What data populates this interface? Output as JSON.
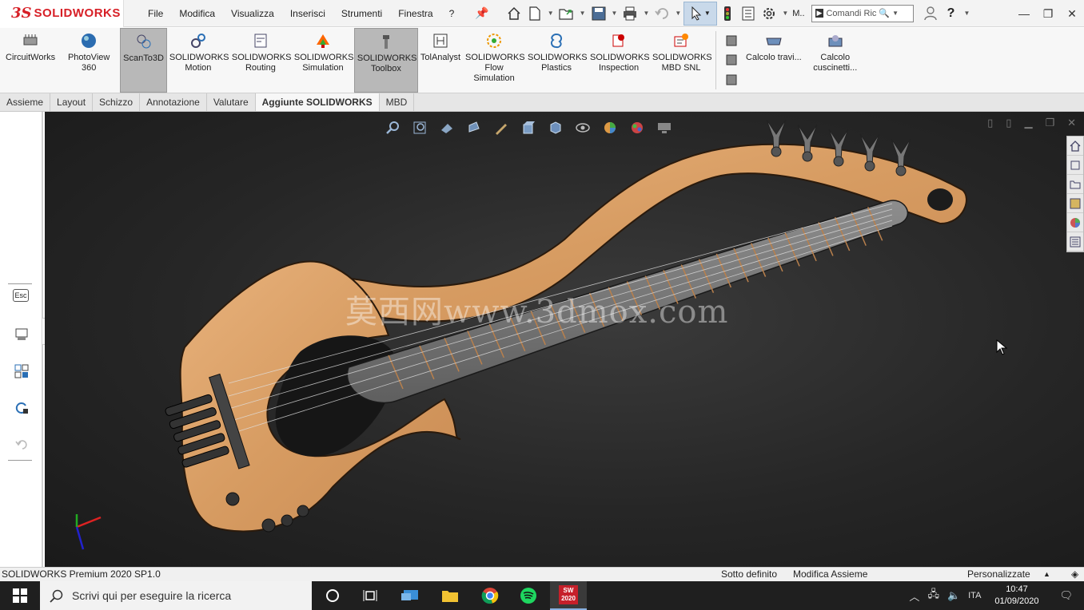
{
  "app": {
    "brand_ds": "3S",
    "brand_name": "SOLIDWORKS"
  },
  "menus": [
    "File",
    "Modifica",
    "Visualizza",
    "Inserisci",
    "Strumenti",
    "Finestra",
    "?"
  ],
  "quick": {
    "selection_dropdown_label": "M..",
    "search_placeholder": "Comandi Ric"
  },
  "ribbon": [
    {
      "label": "CircuitWorks",
      "icon": "circuitworks-icon",
      "active": false
    },
    {
      "label": "PhotoView 360",
      "icon": "photoview-icon",
      "active": false
    },
    {
      "label": "ScanTo3D",
      "icon": "scanto3d-icon",
      "active": true
    },
    {
      "label": "SOLIDWORKS Motion",
      "icon": "motion-icon",
      "active": false
    },
    {
      "label": "SOLIDWORKS Routing",
      "icon": "routing-icon",
      "active": false
    },
    {
      "label": "SOLIDWORKS Simulation",
      "icon": "simulation-icon",
      "active": false
    },
    {
      "label": "SOLIDWORKS Toolbox",
      "icon": "toolbox-icon",
      "active": true
    },
    {
      "label": "TolAnalyst",
      "icon": "tolanalyst-icon",
      "active": false
    },
    {
      "label": "SOLIDWORKS Flow Simulation",
      "icon": "flow-icon",
      "active": false
    },
    {
      "label": "SOLIDWORKS Plastics",
      "icon": "plastics-icon",
      "active": false
    },
    {
      "label": "SOLIDWORKS Inspection",
      "icon": "inspection-icon",
      "active": false
    },
    {
      "label": "SOLIDWORKS MBD SNL",
      "icon": "mbd-icon",
      "active": false
    },
    {
      "label": "Calcolo travi...",
      "icon": "beam-calc-icon",
      "active": false
    },
    {
      "label": "Calcolo cuscinetti...",
      "icon": "bearing-calc-icon",
      "active": false
    }
  ],
  "tabs": [
    {
      "label": "Assieme",
      "selected": false
    },
    {
      "label": "Layout",
      "selected": false
    },
    {
      "label": "Schizzo",
      "selected": false
    },
    {
      "label": "Annotazione",
      "selected": false
    },
    {
      "label": "Valutare",
      "selected": false
    },
    {
      "label": "Aggiunte SOLIDWORKS",
      "selected": true
    },
    {
      "label": "MBD",
      "selected": false
    }
  ],
  "left_panel": {
    "esc_label": "Esc"
  },
  "viewport": {
    "watermark": "莫西网www.3dmox.com"
  },
  "status": {
    "product": "SOLIDWORKS Premium 2020 SP1.0",
    "definition": "Sotto definito",
    "mode": "Modifica Assieme",
    "custom": "Personalizzate"
  },
  "taskbar": {
    "search_placeholder": "Scrivi qui per eseguire la ricerca",
    "language": "ITA",
    "time": "10:47",
    "date": "01/09/2020",
    "sw_badge": "2020"
  },
  "colors": {
    "brand": "#d71f26",
    "wood": "#d9a36c",
    "viewport_bg": "#262626"
  }
}
